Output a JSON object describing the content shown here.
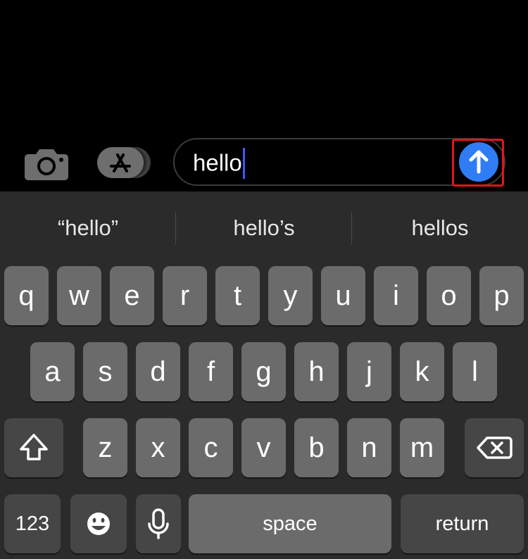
{
  "composer": {
    "message_text": "hello",
    "camera_icon": "camera-icon",
    "apps_icon": "app-store-icon",
    "send_icon": "arrow-up-icon",
    "accent_color": "#2f7cf6",
    "highlight_color": "#e1141e"
  },
  "keyboard": {
    "suggestions": [
      "“hello”",
      "hello’s",
      "hellos"
    ],
    "row1": [
      "q",
      "w",
      "e",
      "r",
      "t",
      "y",
      "u",
      "i",
      "o",
      "p"
    ],
    "row2": [
      "a",
      "s",
      "d",
      "f",
      "g",
      "h",
      "j",
      "k",
      "l"
    ],
    "row3": [
      "z",
      "x",
      "c",
      "v",
      "b",
      "n",
      "m"
    ],
    "shift_icon": "shift-arrow-icon",
    "delete_icon": "delete-backspace-icon",
    "numbers_label": "123",
    "emoji_icon": "emoji-face-icon",
    "mic_icon": "microphone-icon",
    "space_label": "space",
    "return_label": "return"
  }
}
